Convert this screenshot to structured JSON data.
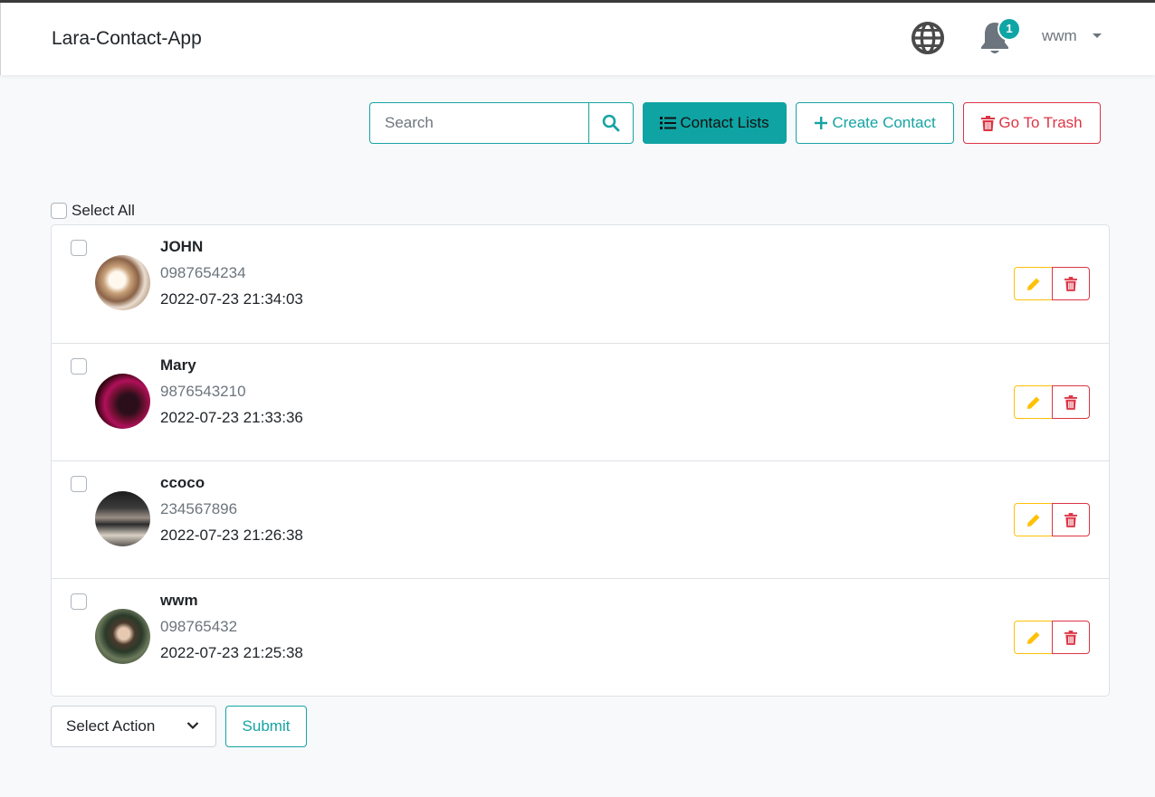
{
  "navbar": {
    "brand": "Lara-Contact-App",
    "notification_count": "1",
    "user_name": "wwm"
  },
  "toolbar": {
    "search_placeholder": "Search",
    "contact_lists_label": "Contact Lists",
    "create_contact_label": "Create Contact",
    "trash_label": "Go To Trash"
  },
  "list": {
    "select_all_label": "Select All"
  },
  "contacts": [
    {
      "name": "JOHN",
      "phone": "0987654234",
      "created": "2022-07-23 21:34:03"
    },
    {
      "name": "Mary",
      "phone": "9876543210",
      "created": "2022-07-23 21:33:36"
    },
    {
      "name": "ccoco",
      "phone": "234567896",
      "created": "2022-07-23 21:26:38"
    },
    {
      "name": "wwm",
      "phone": "098765432",
      "created": "2022-07-23 21:25:38"
    }
  ],
  "bulk": {
    "select_action_label": "Select Action",
    "submit_label": "Submit"
  },
  "colors": {
    "primary": "#0fa3a3",
    "danger": "#dc3545",
    "warning": "#ffc107"
  }
}
